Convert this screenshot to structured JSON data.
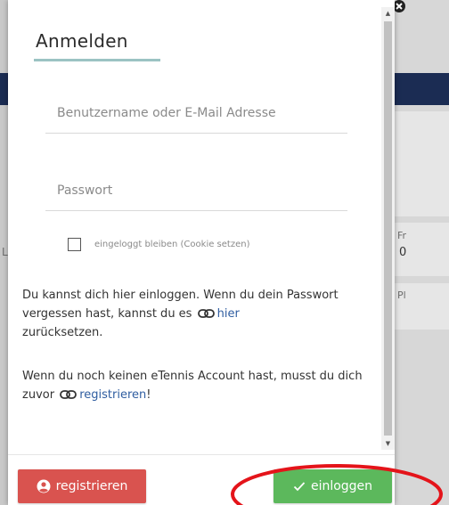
{
  "modal": {
    "title": "Anmelden",
    "username_placeholder": "Benutzername oder E-Mail Adresse",
    "password_placeholder": "Passwort",
    "remember_label": "eingeloggt bleiben (Cookie setzen)",
    "info1": {
      "text_before": "Du kannst dich hier einloggen. Wenn du dein Passwort vergessen hast, kannst du es",
      "link": "hier",
      "text_after": "zurücksetzen."
    },
    "info2": {
      "text_before": "Wenn du noch keinen eTennis Account hast, musst du dich zuvor",
      "link": "registrieren",
      "text_after": "!"
    },
    "register_button": "registrieren",
    "login_button": "einloggen"
  },
  "background": {
    "text_fr": "Fr",
    "text_digit": "0",
    "text_pl": "Pl",
    "text_l": "L"
  },
  "colors": {
    "accent_underline": "#9bc3c3",
    "register": "#d9534f",
    "login": "#5cb85c",
    "link": "#2f5da0",
    "navbar": "#1b2c53",
    "annotation": "#e4141a"
  },
  "icons": {
    "register": "user-circle-icon",
    "login": "checkmark-icon",
    "link": "link-icon",
    "close": "close-icon"
  }
}
